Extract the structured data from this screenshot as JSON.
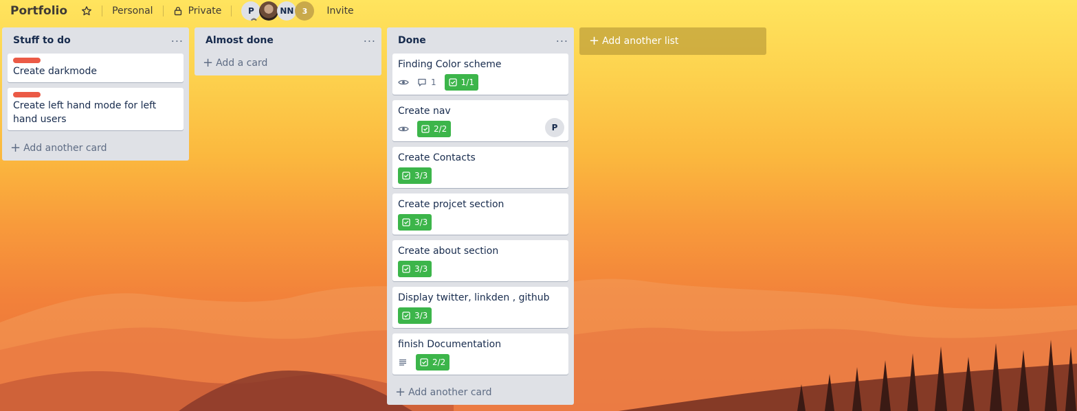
{
  "header": {
    "title": "Portfolio",
    "visibility_workspace": "Personal",
    "visibility_privacy": "Private",
    "members": [
      "P",
      "",
      "NN"
    ],
    "extra_members": "3",
    "invite_label": "Invite"
  },
  "lists": [
    {
      "title": "Stuff to do",
      "add_label": "Add another card",
      "cards": [
        {
          "title": "Create darkmode",
          "label_color": "#eb5a46"
        },
        {
          "title": "Create left hand mode for left hand users",
          "label_color": "#eb5a46"
        }
      ]
    },
    {
      "title": "Almost done",
      "add_label": "Add a card",
      "cards": []
    },
    {
      "title": "Done",
      "add_label": "Add another card",
      "cards": [
        {
          "title": "Finding Color scheme",
          "comments": "1",
          "checklist": "1/1"
        },
        {
          "title": "Create nav",
          "checklist": "2/2",
          "member": "P"
        },
        {
          "title": "Create Contacts",
          "checklist": "3/3"
        },
        {
          "title": "Create projcet section",
          "checklist": "3/3"
        },
        {
          "title": "Create about section",
          "checklist": "3/3"
        },
        {
          "title": "Display twitter, linkden , github",
          "checklist": "3/3"
        },
        {
          "title": "finish Documentation",
          "checklist": "2/2"
        }
      ]
    }
  ],
  "add_list_label": "Add another list",
  "colors": {
    "label_red": "#eb5a46",
    "checklist_complete": "#3cb54a",
    "list_bg": "#dfe1e6"
  }
}
